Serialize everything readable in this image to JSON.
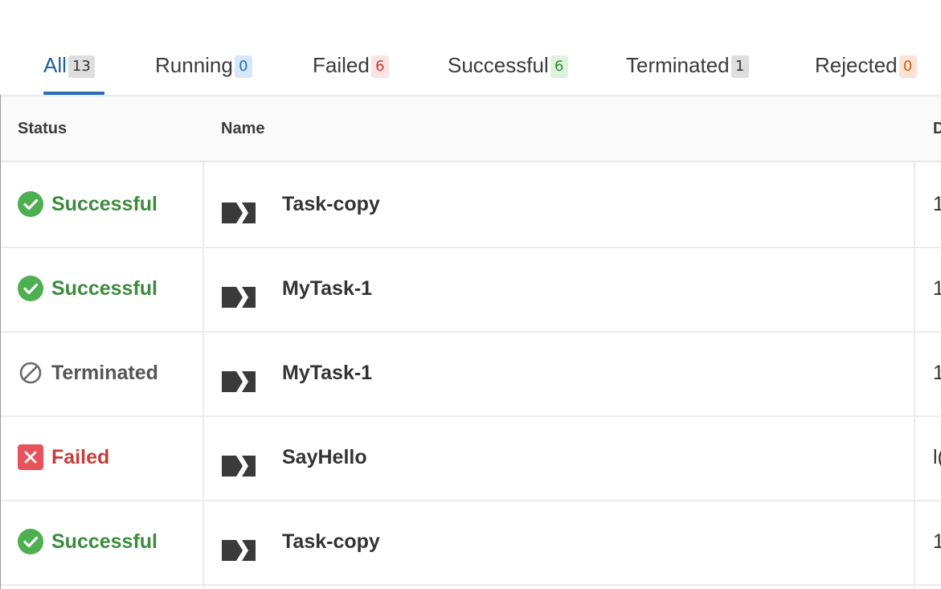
{
  "tabs": [
    {
      "label": "All",
      "count": "13",
      "color": "gray",
      "active": true
    },
    {
      "label": "Running",
      "count": "0",
      "color": "blue"
    },
    {
      "label": "Failed",
      "count": "6",
      "color": "red"
    },
    {
      "label": "Successful",
      "count": "6",
      "color": "green"
    },
    {
      "label": "Terminated",
      "count": "1",
      "color": "gray"
    },
    {
      "label": "Rejected",
      "count": "0",
      "color": "orange"
    }
  ],
  "table": {
    "headers": {
      "status": "Status",
      "name": "Name",
      "third": "D"
    },
    "rows": [
      {
        "status": "Successful",
        "status_icon": "check-circle-icon",
        "name": "Task-copy",
        "third": "1"
      },
      {
        "status": "Successful",
        "status_icon": "check-circle-icon",
        "name": "MyTask-1",
        "third": "1"
      },
      {
        "status": "Terminated",
        "status_icon": "prohibited-icon",
        "name": "MyTask-1",
        "third": "1"
      },
      {
        "status": "Failed",
        "status_icon": "close-square-icon",
        "name": "SayHello",
        "third": "l("
      },
      {
        "status": "Successful",
        "status_icon": "check-circle-icon",
        "name": "Task-copy",
        "third": "1"
      }
    ]
  },
  "colors": {
    "success": "#4caf50",
    "failed": "#e8535b",
    "active_tab": "#2a6db5"
  }
}
